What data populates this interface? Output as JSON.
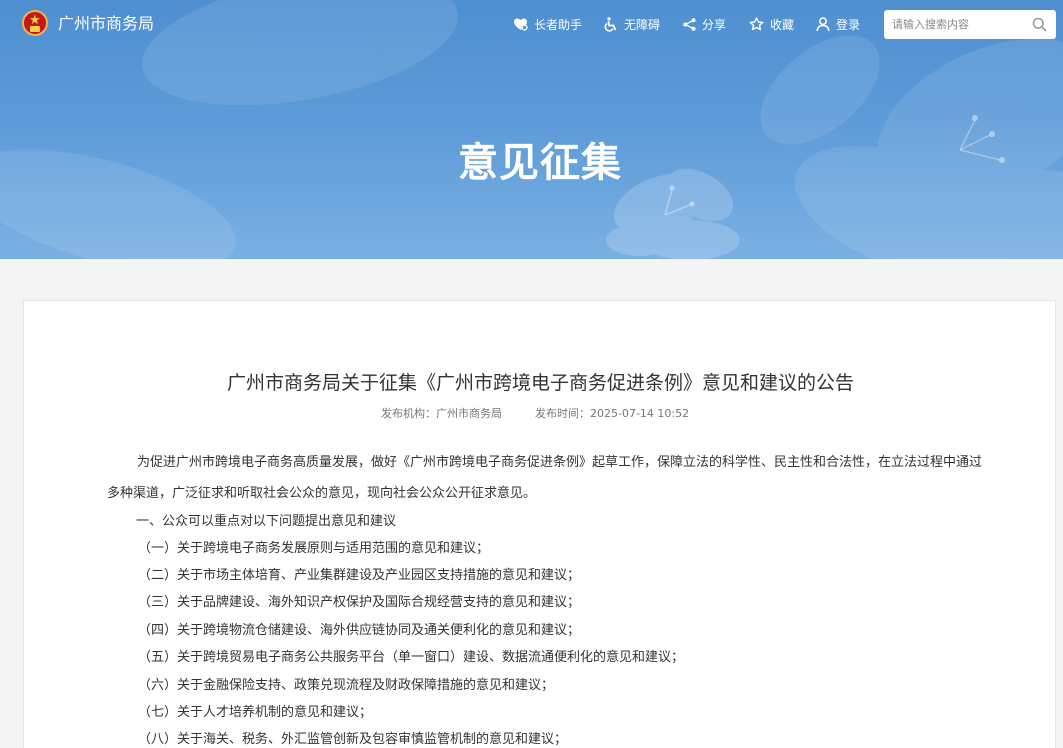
{
  "header": {
    "site_name": "广州市商务局",
    "nav": {
      "elder_mode": "长者助手",
      "accessibility": "无障碍",
      "share": "分享",
      "favorite": "收藏",
      "login": "登录"
    },
    "search": {
      "placeholder": "请输入搜索内容"
    }
  },
  "banner": {
    "title": "意见征集"
  },
  "article": {
    "title": "广州市商务局关于征集《广州市跨境电子商务促进条例》意见和建议的公告",
    "publisher": "发布机构：广州市商务局",
    "publish_time": "发布时间：2025-07-14 10:52",
    "intro": "为促进广州市跨境电子商务高质量发展，做好《广州市跨境电子商务促进条例》起草工作，保障立法的科学性、民主性和合法性，在立法过程中通过多种渠道，广泛征求和听取社会公众的意见，现向社会公众公开征求意见。",
    "section_heading": "一、公众可以重点对以下问题提出意见和建议",
    "items": [
      "（一）关于跨境电子商务发展原则与适用范围的意见和建议；",
      "（二）关于市场主体培育、产业集群建设及产业园区支持措施的意见和建议；",
      "（三）关于品牌建设、海外知识产权保护及国际合规经营支持的意见和建议；",
      "（四）关于跨境物流仓储建设、海外供应链协同及通关便利化的意见和建议；",
      "（五）关于跨境贸易电子商务公共服务平台（单一窗口）建设、数据流通便利化的意见和建议；",
      "（六）关于金融保险支持、政策兑现流程及财政保障措施的意见和建议；",
      "（七）关于人才培养机制的意见和建议；",
      "（八）关于海关、税务、外汇监管创新及包容审慎监管机制的意见和建议；"
    ]
  },
  "colors": {
    "banner": "#5c9ad8",
    "text": "#333333",
    "meta": "#777777"
  },
  "icons": [
    "emblem-logo",
    "elder-care-icon",
    "wheelchair-icon",
    "share-icon",
    "star-icon",
    "user-icon",
    "search-icon"
  ]
}
